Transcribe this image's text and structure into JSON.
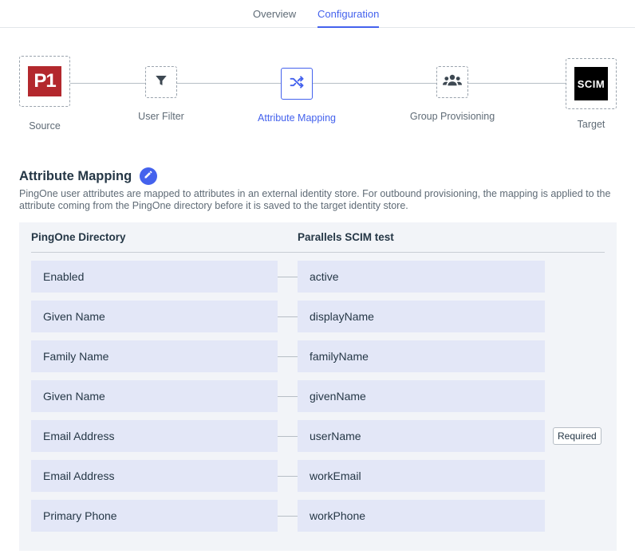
{
  "tabs": [
    {
      "label": "Overview",
      "active": false
    },
    {
      "label": "Configuration",
      "active": true
    }
  ],
  "stepper": {
    "steps": [
      {
        "label": "Source",
        "icon": "pingone-p1-logo",
        "logo_text": "P1"
      },
      {
        "label": "User Filter",
        "icon": "filter-icon"
      },
      {
        "label": "Attribute Mapping",
        "icon": "shuffle-icon",
        "active": true
      },
      {
        "label": "Group Provisioning",
        "icon": "group-icon"
      },
      {
        "label": "Target",
        "icon": "scim-logo",
        "logo_text": "SCIM"
      }
    ]
  },
  "section": {
    "title": "Attribute Mapping",
    "edit_icon": "pencil-icon",
    "description": "PingOne user attributes are mapped to attributes in an external identity store. For outbound provisioning, the mapping is applied to the attribute coming from the PingOne directory before it is saved to the target identity store."
  },
  "mapping": {
    "source_header": "PingOne Directory",
    "target_header": "Parallels SCIM test",
    "rows": [
      {
        "source": "Enabled",
        "target": "active",
        "badge": ""
      },
      {
        "source": "Given Name",
        "target": "displayName",
        "badge": ""
      },
      {
        "source": "Family Name",
        "target": "familyName",
        "badge": ""
      },
      {
        "source": "Given Name",
        "target": "givenName",
        "badge": ""
      },
      {
        "source": "Email Address",
        "target": "userName",
        "badge": "Required"
      },
      {
        "source": "Email Address",
        "target": "workEmail",
        "badge": ""
      },
      {
        "source": "Primary Phone",
        "target": "workPhone",
        "badge": ""
      }
    ]
  },
  "colors": {
    "accent": "#4462ed",
    "pingone_red": "#b3282d",
    "cell_bg": "#e3e7f7",
    "panel_bg": "#f2f4f8"
  }
}
